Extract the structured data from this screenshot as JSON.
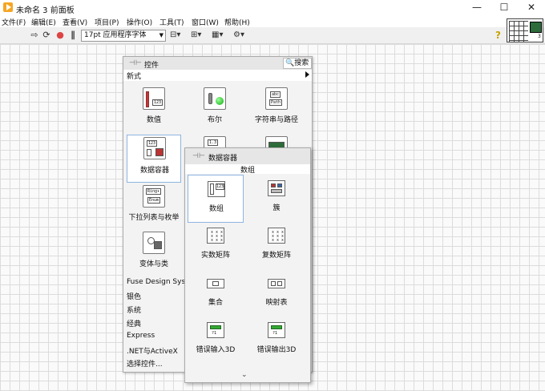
{
  "window": {
    "title": "未命名 3 前面板",
    "min": "—",
    "max": "☐",
    "close": "✕"
  },
  "menu": [
    "文件(F)",
    "编辑(E)",
    "查看(V)",
    "项目(P)",
    "操作(O)",
    "工具(T)",
    "窗口(W)",
    "帮助(H)"
  ],
  "toolbar": {
    "font": "17pt 应用程序字体",
    "vi_icon_number": "3"
  },
  "palette": {
    "title": "控件",
    "search": "搜索",
    "subcategory": "新式",
    "items": [
      "数值",
      "布尔",
      "字符串与路径",
      "数据容器",
      "",
      "",
      "下拉列表与枚举",
      "变体与类"
    ],
    "categories": [
      "Fuse Design System",
      "银色",
      "系统",
      "经典",
      "Express",
      ".NET与ActiveX",
      "选择控件..."
    ]
  },
  "subpalette": {
    "title": "数据容器",
    "row_label": "数组",
    "items": [
      "数组",
      "簇",
      "实数矩阵",
      "复数矩阵",
      "集合",
      "映射表",
      "错误输入3D",
      "错误输出3D"
    ],
    "more": "⌄"
  }
}
